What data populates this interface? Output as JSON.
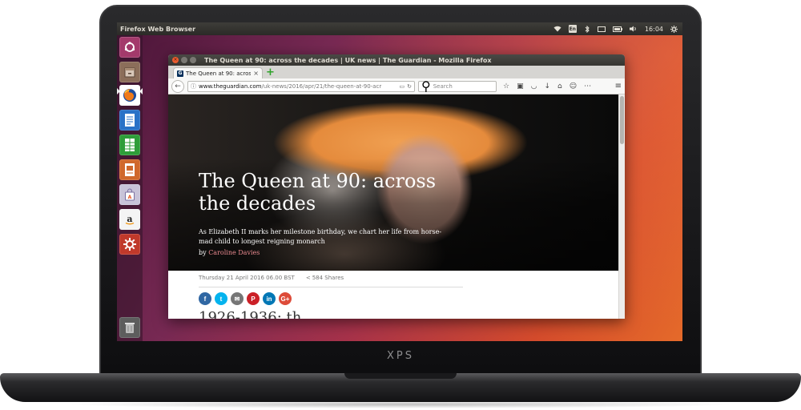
{
  "device": {
    "brand": "XPS"
  },
  "panel": {
    "app_title": "Firefox Web Browser",
    "clock": "16:04",
    "keyboard_layout": "En"
  },
  "launcher": {
    "items": [
      {
        "name": "Ubuntu Dash",
        "icon": "ubuntu-logo-icon",
        "color": "#a33a6b"
      },
      {
        "name": "Files",
        "icon": "file-cabinet-icon",
        "color": "#8c6e5a"
      },
      {
        "name": "Firefox Web Browser",
        "icon": "firefox-icon",
        "color": "#e66000",
        "active": true
      },
      {
        "name": "LibreOffice Writer",
        "icon": "writer-document-icon",
        "color": "#2a72c7"
      },
      {
        "name": "LibreOffice Calc",
        "icon": "calc-spreadsheet-icon",
        "color": "#2f9d3a"
      },
      {
        "name": "LibreOffice Impress",
        "icon": "impress-presentation-icon",
        "color": "#d0682c"
      },
      {
        "name": "Ubuntu Software",
        "icon": "shopping-bag-icon",
        "color": "#c8c3d8"
      },
      {
        "name": "Amazon",
        "icon": "amazon-icon",
        "color": "#d9d9d9"
      },
      {
        "name": "System Settings",
        "icon": "settings-gear-icon",
        "color": "#c0392b"
      },
      {
        "name": "Trash",
        "icon": "trash-icon",
        "color": "#6a6a6a"
      }
    ]
  },
  "window": {
    "title": "The Queen at 90: across the decades | UK news | The Guardian - Mozilla Firefox",
    "tab": {
      "favicon": "G",
      "label": "The Queen at 90: across t"
    },
    "url": {
      "host": "www.theguardian.com",
      "path": "/uk-news/2016/apr/21/the-queen-at-90-acr"
    },
    "search_placeholder": "Search"
  },
  "article": {
    "headline": "The Queen at 90: across the decades",
    "standfirst": "As Elizabeth II marks her milestone birthday, we chart her life from horse-mad child to longest reigning monarch",
    "byline_prefix": "by",
    "author": "Caroline Davies",
    "date": "Thursday 21 April 2016 06.00 BST",
    "shares": "584 Shares",
    "share_buttons": [
      "f",
      "t",
      "✉",
      "P",
      "in",
      "G+"
    ],
    "section_heading": "1926-1936: th"
  },
  "colors": {
    "ubuntu_orange": "#e95420",
    "guardian_blue": "#05305c",
    "author_link": "#e9898f"
  }
}
